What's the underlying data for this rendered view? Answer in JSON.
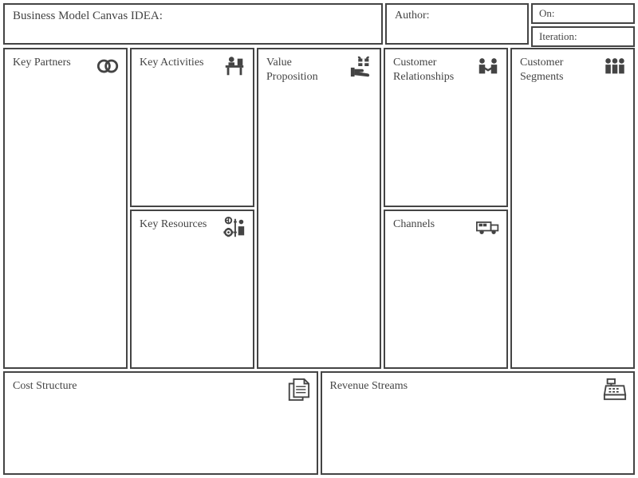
{
  "header": {
    "title_label": "Business Model Canvas IDEA:",
    "author_label": "Author:",
    "on_label": "On:",
    "iteration_label": "Iteration:"
  },
  "cells": {
    "key_partners": "Key Partners",
    "key_activities": "Key Activities",
    "key_resources": "Key Resources",
    "value_proposition": "Value Proposition",
    "customer_relationships": "Customer Relationships",
    "channels": "Channels",
    "customer_segments": "Customer Segments",
    "cost_structure": "Cost Structure",
    "revenue_streams": "Revenue Streams"
  }
}
